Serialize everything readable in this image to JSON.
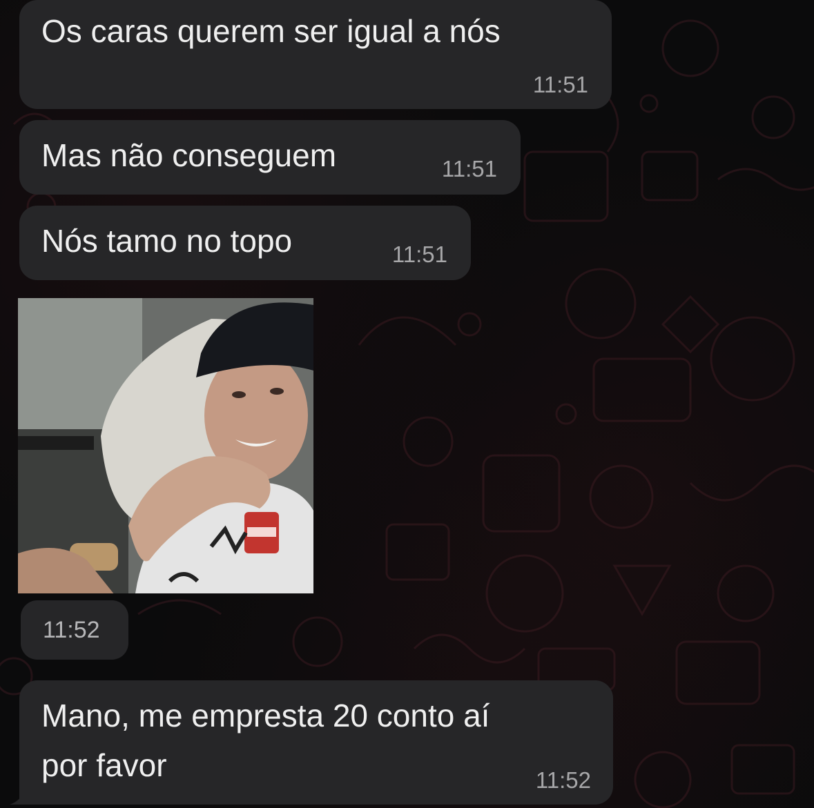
{
  "messages": [
    {
      "text": "Os caras querem ser igual a nós",
      "time": "11:51"
    },
    {
      "text": "Mas não conseguem",
      "time": "11:51"
    },
    {
      "text": "Nós tamo no topo",
      "time": "11:51"
    },
    {
      "image": "photo-message",
      "time": "11:52"
    },
    {
      "text_line1": "Mano, me empresta 20 conto aí",
      "text_line2": "por favor",
      "time": "11:52"
    }
  ],
  "colors": {
    "bubble": "#262628",
    "background": "#0b0b0c",
    "doodle_stroke": "#3a1a20",
    "text": "#efefef",
    "timestamp": "#a7a7a9"
  }
}
